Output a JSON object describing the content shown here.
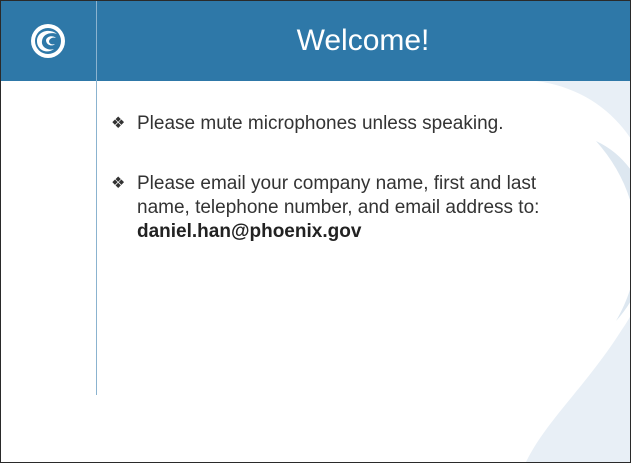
{
  "slide": {
    "title": "Welcome!",
    "logo_icon": "phoenix-logo-icon",
    "bullet_icon": "diamond-bullet-icon",
    "bullets": [
      {
        "text": "Please mute microphones unless speaking."
      },
      {
        "text": "Please email your company name, first and last name, telephone number, and email address to:",
        "email": "daniel.han@phoenix.gov"
      }
    ]
  },
  "colors": {
    "header": "#2e78a8",
    "watermark": "#dde7f0",
    "divider": "#8bb3cf",
    "body_text": "#333333"
  }
}
